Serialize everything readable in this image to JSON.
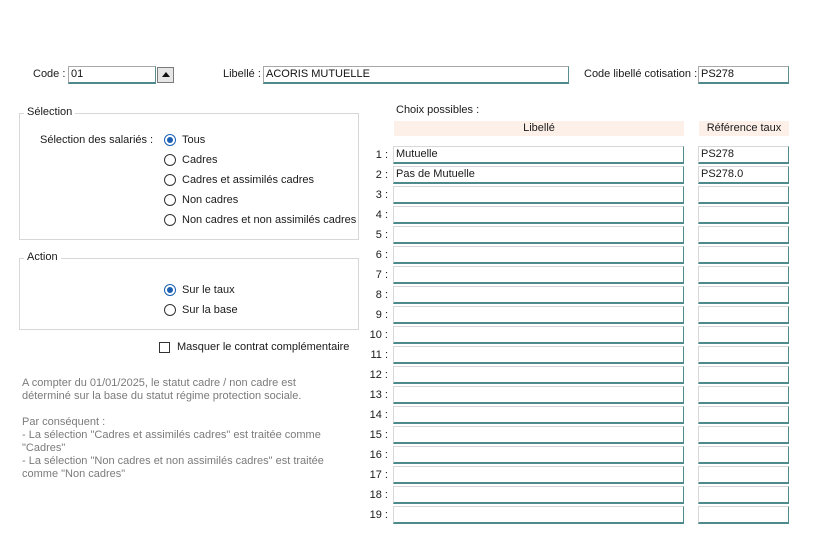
{
  "header": {
    "code_label": "Code :",
    "code_value": "01",
    "libelle_label": "Libellé :",
    "libelle_value": "ACORIS MUTUELLE",
    "code_libelle_cotisation_label": "Code libellé cotisation :",
    "code_libelle_cotisation_value": "PS278"
  },
  "selection": {
    "title": "Sélection",
    "label": "Sélection des salariés :",
    "options": [
      {
        "label": "Tous",
        "checked": true
      },
      {
        "label": "Cadres",
        "checked": false
      },
      {
        "label": "Cadres et assimilés cadres",
        "checked": false
      },
      {
        "label": "Non cadres",
        "checked": false
      },
      {
        "label": "Non cadres et non assimilés cadres",
        "checked": false
      }
    ]
  },
  "action": {
    "title": "Action",
    "options": [
      {
        "label": "Sur le taux",
        "checked": true
      },
      {
        "label": "Sur la base",
        "checked": false
      }
    ]
  },
  "masquer_checkbox": {
    "label": "Masquer le contrat complémentaire",
    "checked": false
  },
  "info_note": {
    "paragraph1": "A compter du 01/01/2025, le statut cadre / non cadre est\ndéterminé sur la base du statut régime protection sociale.",
    "paragraph2": "Par conséquent :\n- La sélection \"Cadres et assimilés cadres\" est traitée comme\n\"Cadres\"\n- La sélection \"Non cadres et non assimilés cadres\" est traitée\ncomme \"Non cadres\""
  },
  "choix": {
    "title": "Choix possibles :",
    "col_libelle": "Libellé",
    "col_reference": "Référence taux",
    "rows": [
      {
        "num": "1 :",
        "libelle": "Mutuelle",
        "reference": "PS278"
      },
      {
        "num": "2 :",
        "libelle": "Pas de Mutuelle",
        "reference": "PS278.0"
      },
      {
        "num": "3 :",
        "libelle": "",
        "reference": ""
      },
      {
        "num": "4 :",
        "libelle": "",
        "reference": ""
      },
      {
        "num": "5 :",
        "libelle": "",
        "reference": ""
      },
      {
        "num": "6 :",
        "libelle": "",
        "reference": ""
      },
      {
        "num": "7 :",
        "libelle": "",
        "reference": ""
      },
      {
        "num": "8 :",
        "libelle": "",
        "reference": ""
      },
      {
        "num": "9 :",
        "libelle": "",
        "reference": ""
      },
      {
        "num": "10 :",
        "libelle": "",
        "reference": ""
      },
      {
        "num": "11 :",
        "libelle": "",
        "reference": ""
      },
      {
        "num": "12 :",
        "libelle": "",
        "reference": ""
      },
      {
        "num": "13 :",
        "libelle": "",
        "reference": ""
      },
      {
        "num": "14 :",
        "libelle": "",
        "reference": ""
      },
      {
        "num": "15 :",
        "libelle": "",
        "reference": ""
      },
      {
        "num": "16 :",
        "libelle": "",
        "reference": ""
      },
      {
        "num": "17 :",
        "libelle": "",
        "reference": ""
      },
      {
        "num": "18 :",
        "libelle": "",
        "reference": ""
      },
      {
        "num": "19 :",
        "libelle": "",
        "reference": ""
      }
    ]
  }
}
